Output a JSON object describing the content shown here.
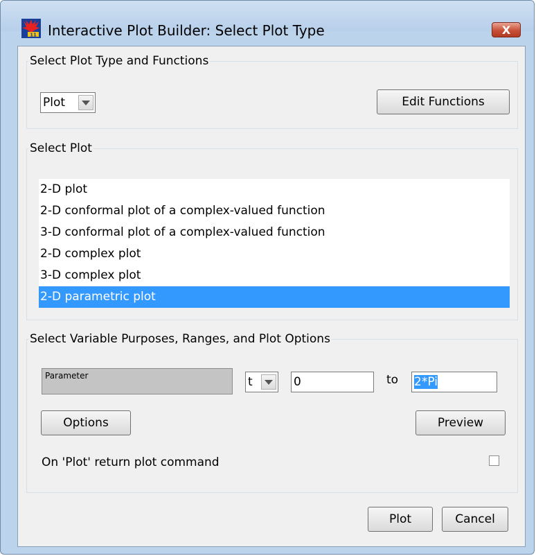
{
  "window": {
    "title": "Interactive Plot Builder: Select Plot Type",
    "close_label": "X"
  },
  "plot_type_group": {
    "legend": "Select Plot Type and Functions",
    "plot_type_value": "Plot",
    "edit_functions_label": "Edit Functions"
  },
  "select_plot_group": {
    "legend": "Select Plot",
    "items": [
      {
        "label": "2-D plot",
        "selected": false
      },
      {
        "label": "2-D conformal plot of a complex-valued function",
        "selected": false
      },
      {
        "label": "3-D conformal plot of a complex-valued function",
        "selected": false
      },
      {
        "label": "2-D complex plot",
        "selected": false
      },
      {
        "label": "3-D complex plot",
        "selected": false
      },
      {
        "label": "2-D parametric plot",
        "selected": true
      }
    ]
  },
  "variables_group": {
    "legend": "Select Variable Purposes, Ranges, and Plot Options",
    "purpose_label": "Parameter",
    "variable_value": "t",
    "range_from": "0",
    "to_label": "to",
    "range_to": "2*Pi",
    "options_label": "Options",
    "preview_label": "Preview",
    "return_command_label": "On 'Plot' return plot command",
    "return_command_checked": false
  },
  "footer": {
    "plot_label": "Plot",
    "cancel_label": "Cancel"
  }
}
